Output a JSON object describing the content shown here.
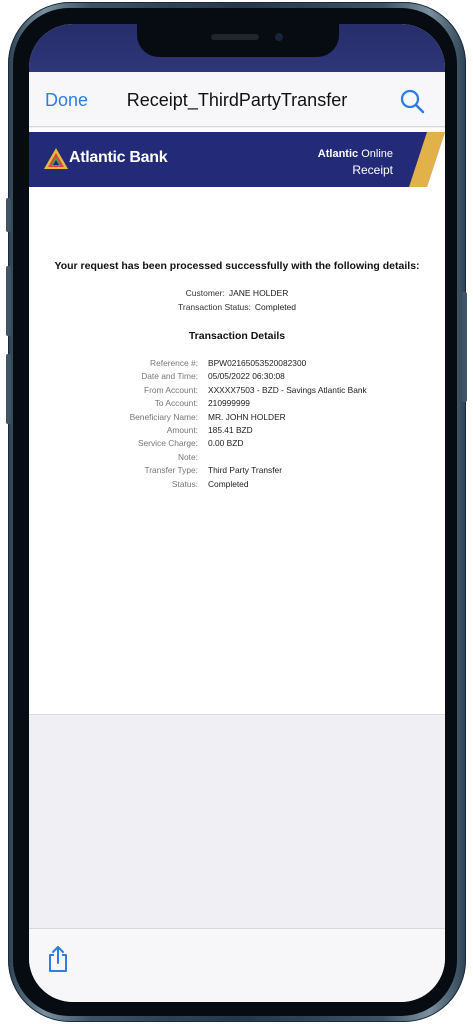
{
  "nav": {
    "done_label": "Done",
    "title": "Receipt_ThirdPartyTransfer",
    "search_icon": "magnifier-icon",
    "accent_color": "#2f7de1"
  },
  "bank_header": {
    "logo_text": "Atlantic Bank",
    "product_name_bold": "Atlantic",
    "product_name_light": "Online",
    "receipt_label": "Receipt",
    "header_color": "#232b78",
    "stripe_color": "#e2b24a"
  },
  "receipt": {
    "success_message": "Your request has been processed successfully with the following details:",
    "customer_label": "Customer:",
    "customer_value": "JANE HOLDER",
    "status_label": "Transaction Status:",
    "status_value": "Completed",
    "section_title": "Transaction Details",
    "details": [
      {
        "label": "Reference #:",
        "value": "BPW02165053520082300"
      },
      {
        "label": "Date and Time:",
        "value": "05/05/2022 06:30:08"
      },
      {
        "label": "From Account:",
        "value": "XXXXX7503 - BZD - Savings Atlantic Bank"
      },
      {
        "label": "To Account:",
        "value": "210999999"
      },
      {
        "label": "Beneficiary Name:",
        "value": "MR. JOHN HOLDER"
      },
      {
        "label": "Amount:",
        "value": "185.41 BZD"
      },
      {
        "label": "Service Charge:",
        "value": "0.00 BZD"
      },
      {
        "label": "Note:",
        "value": ""
      },
      {
        "label": "Transfer Type:",
        "value": "Third Party Transfer"
      },
      {
        "label": "Status:",
        "value": "Completed"
      }
    ]
  },
  "toolbar": {
    "share_icon": "share-icon"
  }
}
